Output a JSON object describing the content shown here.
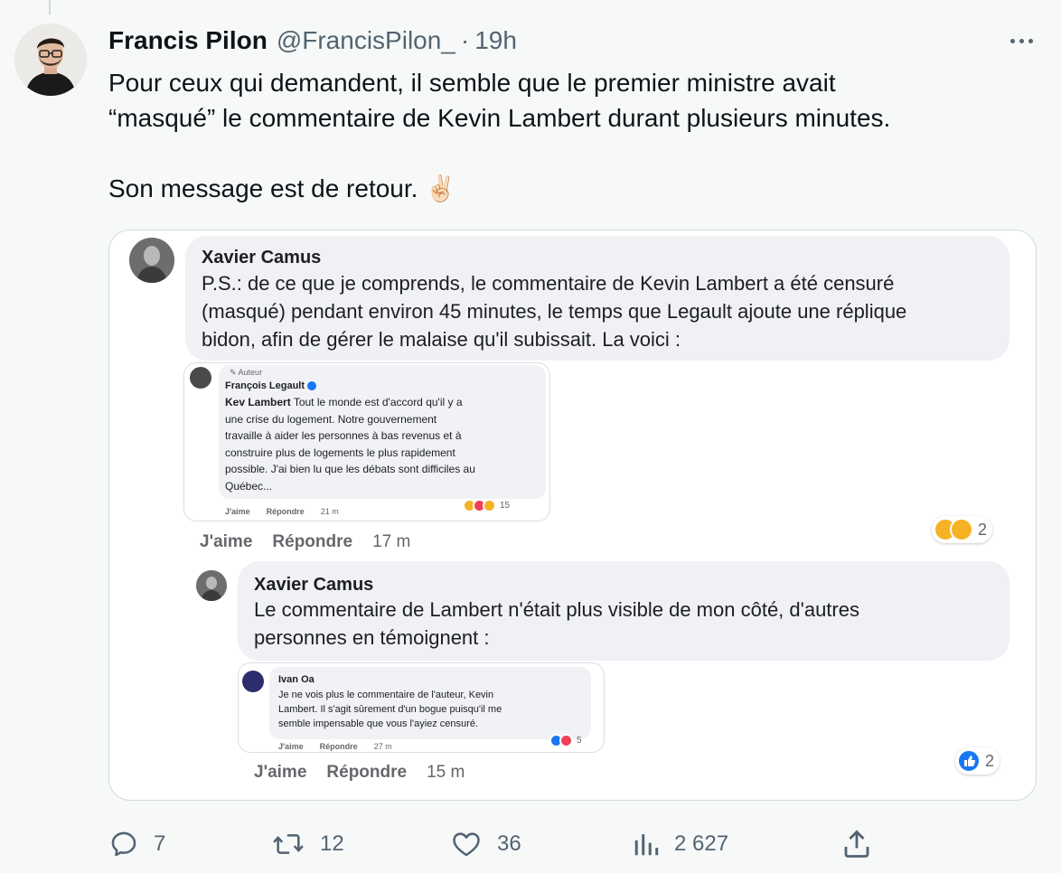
{
  "tweet": {
    "author_name": "Francis Pilon",
    "handle": "@FrancisPilon_",
    "separator": "·",
    "time": "19h",
    "text_lines": [
      "Pour ceux qui demandent, il semble que le premier ministre avait",
      "“masqué” le commentaire de Kevin Lambert durant plusieurs minutes.",
      "Son message est de retour. ✌🏻"
    ]
  },
  "media": {
    "comment1": {
      "name": "Xavier Camus",
      "lines": [
        "P.S.: de ce que je comprends, le commentaire de Kevin Lambert a été censuré",
        "(masqué) pendant environ 45 minutes, le temps que Legault ajoute une réplique",
        "bidon, afin de gérer le malaise qu'il subissait. La voici :"
      ],
      "embedded": {
        "label": "Auteur",
        "name": "François Legault",
        "mention": "Kev Lambert",
        "lines": [
          " Tout le monde est d'accord qu'il y a",
          "une crise du logement. Notre gouvernement",
          "travaille à aider les personnes à bas revenus et à",
          "construire plus de logements le plus rapidement",
          "possible. J'ai bien lu que les débats sont difficiles au",
          "Québec..."
        ],
        "like": "J'aime",
        "reply": "Répondre",
        "time": "21 m",
        "reaction_count": "15"
      },
      "like": "J'aime",
      "reply": "Répondre",
      "time": "17 m",
      "reaction_count": "2"
    },
    "comment2": {
      "name": "Xavier Camus",
      "lines": [
        "Le commentaire de Lambert n'était plus visible de mon côté, d'autres",
        "personnes en témoignent :"
      ],
      "embedded": {
        "name": "Ivan Oa",
        "lines": [
          "Je ne vois plus le commentaire de l'auteur, Kevin",
          "Lambert. Il s'agit sûrement d'un bogue puisqu'il me",
          "semble impensable que vous l'ayiez censuré."
        ],
        "like": "J'aime",
        "reply": "Répondre",
        "time": "27 m",
        "reaction_count": "5"
      },
      "like": "J'aime",
      "reply": "Répondre",
      "time": "15 m",
      "reaction_count": "2"
    }
  },
  "actions": {
    "replies": {
      "icon": "reply-icon",
      "count": "7"
    },
    "reposts": {
      "icon": "repost-icon",
      "count": "12"
    },
    "likes": {
      "icon": "heart-icon",
      "count": "36"
    },
    "views": {
      "icon": "views-icon",
      "count": "2 627"
    },
    "share": {
      "icon": "share-icon"
    }
  },
  "colors": {
    "background": "#f7f9f9",
    "text": "#0f1419",
    "secondary": "#536471",
    "bubble": "#eff1f4",
    "facebook_blue": "#1877f2"
  }
}
